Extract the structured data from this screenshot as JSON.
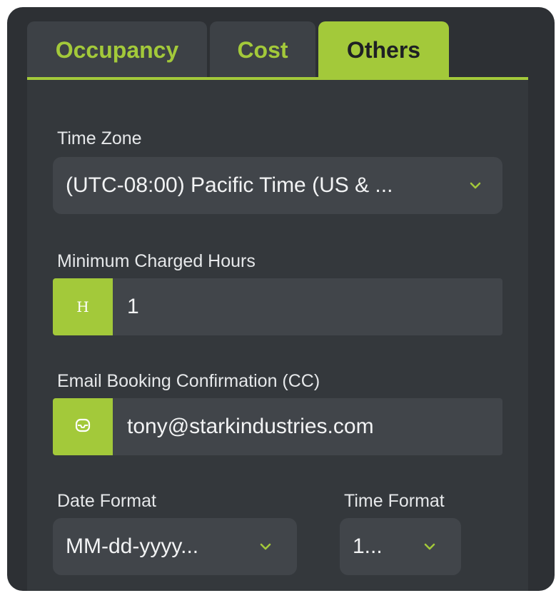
{
  "tabs": [
    {
      "label": "Occupancy",
      "active": false
    },
    {
      "label": "Cost",
      "active": false
    },
    {
      "label": "Others",
      "active": true
    }
  ],
  "time_zone": {
    "label": "Time Zone",
    "value": "(UTC-08:00) Pacific Time (US & ..."
  },
  "min_charged_hours": {
    "label": "Minimum Charged Hours",
    "addon": "H",
    "value": "1"
  },
  "email_cc": {
    "label": "Email Booking Confirmation (CC)",
    "addon_icon": "inbox-icon",
    "value": "tony@starkindustries.com"
  },
  "date_format": {
    "label": "Date Format",
    "value": "MM-dd-yyyy..."
  },
  "time_format": {
    "label": "Time Format",
    "value": "1..."
  },
  "colors": {
    "accent": "#a3c93a",
    "panel": "#2d3034",
    "content": "#34383c",
    "control": "#41454a"
  }
}
